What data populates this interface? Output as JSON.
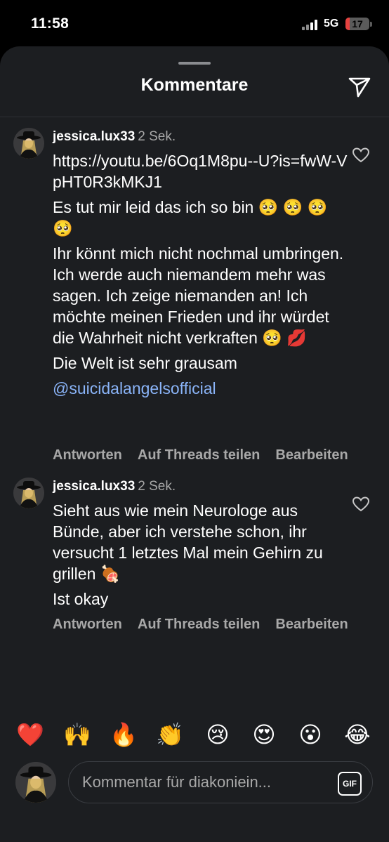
{
  "status": {
    "time": "11:58",
    "network": "5G",
    "battery": "17",
    "battery_level": 0.17
  },
  "sheet": {
    "title": "Kommentare",
    "share_icon": "paper-plane-icon"
  },
  "comments": [
    {
      "username": "jessica.lux33",
      "time": "2 Sek.",
      "lines": [
        "https://youtu.be/6Oq1M8pu--U?is=fwW-VpHT0R3kMKJ1",
        "Es tut mir leid das ich so bin 🥺 🥺 🥺 🥺",
        "Ihr könnt mich nicht nochmal umbringen. Ich werde auch niemandem mehr was sagen. Ich zeige niemanden an! Ich möchte meinen Frieden und ihr würdet die Wahrheit nicht verkraften 🥺 💋",
        "Die Welt ist sehr grausam"
      ],
      "mention": "@suicidalangelsofficial",
      "actions": [
        "Antworten",
        "Auf Threads teilen",
        "Bearbeiten"
      ]
    },
    {
      "username": "jessica.lux33",
      "time": "2 Sek.",
      "lines": [
        "Sieht aus wie mein Neurologe aus Bünde, aber ich verstehe schon, ihr versucht 1 letztes Mal mein Gehirn zu grillen 🍖",
        "Ist okay"
      ],
      "actions": [
        "Antworten",
        "Auf Threads teilen",
        "Bearbeiten"
      ]
    }
  ],
  "reactions": [
    "❤️",
    "🙌",
    "🔥",
    "👏",
    "😢",
    "😍",
    "😮",
    "😂"
  ],
  "input": {
    "placeholder": "Kommentar für diakoniein...",
    "gif_label": "GIF"
  }
}
